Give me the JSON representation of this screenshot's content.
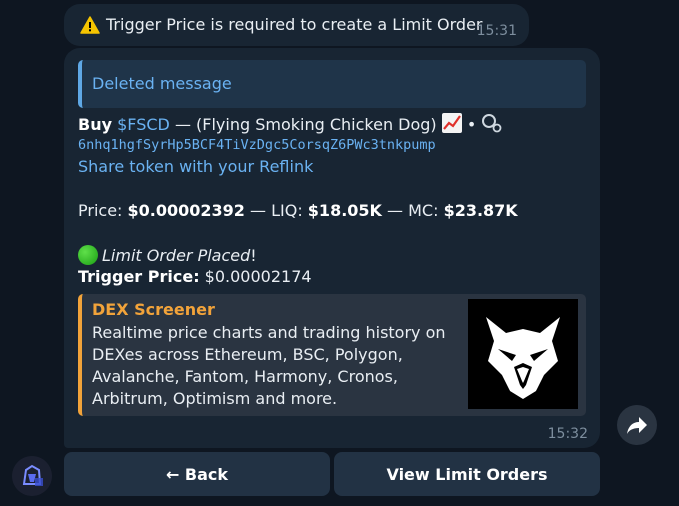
{
  "messages": {
    "top": {
      "icon": "warning-icon",
      "text": "Trigger Price is required to create a Limit Order",
      "time": "15:31"
    },
    "main": {
      "reply_text": "Deleted message",
      "buy_word": "Buy",
      "ticker": "$FSCD",
      "token_name": " — (Flying Smoking Chicken Dog) ",
      "chart_emoji": "📈",
      "bullet": "•",
      "token_address": "6nhq1hgfSyrHp5BCF4TiVzDgc5CorsqZ6PWc3tnkpump",
      "reflink": "Share token with your Reflink",
      "price_label": "Price: ",
      "price_value": "$0.00002392",
      "liq_label": " — LIQ: ",
      "liq_value": "$18.05K",
      "mc_label": " — MC: ",
      "mc_value": "$23.87K",
      "status_text": "Limit Order Placed",
      "status_suffix": "!",
      "trigger_label": "Trigger Price:",
      "trigger_value": " $0.00002174",
      "preview": {
        "site": "DEX Screener",
        "description": "Realtime price charts and trading history on DEXes across Ethereum, BSC, Polygon, Avalanche, Fantom, Harmony, Cronos, Arbitrum, Optimism and more."
      },
      "time": "15:32"
    }
  },
  "keyboard": {
    "back_label": "← Back",
    "view_orders_label": "View Limit Orders"
  },
  "colors": {
    "background": "#0e1621",
    "bubble": "#182533",
    "link": "#6ab2f2",
    "preview_accent": "#f2a33a",
    "status_green": "#27c11b"
  }
}
